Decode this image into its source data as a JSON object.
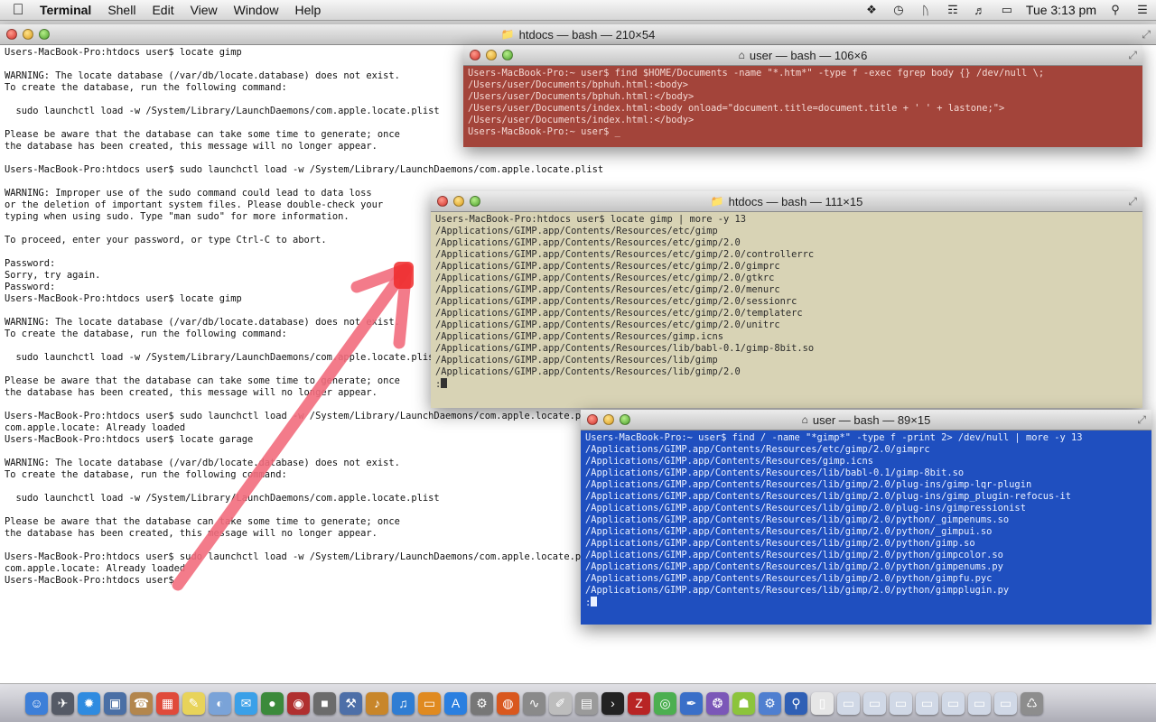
{
  "menubar": {
    "apple_icon": "apple-icon",
    "app_name": "Terminal",
    "menus": [
      "Shell",
      "Edit",
      "View",
      "Window",
      "Help"
    ],
    "clock": "Tue 3:13 pm",
    "status_icons": [
      "dropbox-icon",
      "time-machine-icon",
      "bluetooth-icon",
      "wifi-icon",
      "volume-icon",
      "battery-icon",
      "spotlight-search-icon",
      "notification-list-icon"
    ]
  },
  "main_window": {
    "title": "htdocs — bash — 210×54",
    "lines": [
      "Users-MacBook-Pro:htdocs user$ locate gimp",
      "",
      "WARNING: The locate database (/var/db/locate.database) does not exist.",
      "To create the database, run the following command:",
      "",
      "  sudo launchctl load -w /System/Library/LaunchDaemons/com.apple.locate.plist",
      "",
      "Please be aware that the database can take some time to generate; once",
      "the database has been created, this message will no longer appear.",
      "",
      "Users-MacBook-Pro:htdocs user$ sudo launchctl load -w /System/Library/LaunchDaemons/com.apple.locate.plist",
      "",
      "WARNING: Improper use of the sudo command could lead to data loss",
      "or the deletion of important system files. Please double-check your",
      "typing when using sudo. Type \"man sudo\" for more information.",
      "",
      "To proceed, enter your password, or type Ctrl-C to abort.",
      "",
      "Password:",
      "Sorry, try again.",
      "Password:",
      "Users-MacBook-Pro:htdocs user$ locate gimp",
      "",
      "WARNING: The locate database (/var/db/locate.database) does not exist.",
      "To create the database, run the following command:",
      "",
      "  sudo launchctl load -w /System/Library/LaunchDaemons/com.apple.locate.plist",
      "",
      "Please be aware that the database can take some time to generate; once",
      "the database has been created, this message will no longer appear.",
      "",
      "Users-MacBook-Pro:htdocs user$ sudo launchctl load -w /System/Library/LaunchDaemons/com.apple.locate.plist",
      "com.apple.locate: Already loaded",
      "Users-MacBook-Pro:htdocs user$ locate garage",
      "",
      "WARNING: The locate database (/var/db/locate.database) does not exist.",
      "To create the database, run the following command:",
      "",
      "  sudo launchctl load -w /System/Library/LaunchDaemons/com.apple.locate.plist",
      "",
      "Please be aware that the database can take some time to generate; once",
      "the database has been created, this message will no longer appear.",
      "",
      "Users-MacBook-Pro:htdocs user$ sudo launchctl load -w /System/Library/LaunchDaemons/com.apple.locate.plist",
      "com.apple.locate: Already loaded",
      "Users-MacBook-Pro:htdocs user$ "
    ]
  },
  "red_window": {
    "title": "user — bash — 106×6",
    "lines": [
      "Users-MacBook-Pro:~ user$ find $HOME/Documents -name \"*.htm*\" -type f -exec fgrep body {} /dev/null \\;",
      "/Users/user/Documents/bphuh.html:<body>",
      "/Users/user/Documents/bphuh.html:</body>",
      "/Users/user/Documents/index.html:<body onload=\"document.title=document.title + ' ' + lastone;\">",
      "/Users/user/Documents/index.html:</body>",
      "Users-MacBook-Pro:~ user$ _"
    ]
  },
  "beige_window": {
    "title": "htdocs — bash — 111×15",
    "lines": [
      "Users-MacBook-Pro:htdocs user$ locate gimp | more -y 13",
      "/Applications/GIMP.app/Contents/Resources/etc/gimp",
      "/Applications/GIMP.app/Contents/Resources/etc/gimp/2.0",
      "/Applications/GIMP.app/Contents/Resources/etc/gimp/2.0/controllerrc",
      "/Applications/GIMP.app/Contents/Resources/etc/gimp/2.0/gimprc",
      "/Applications/GIMP.app/Contents/Resources/etc/gimp/2.0/gtkrc",
      "/Applications/GIMP.app/Contents/Resources/etc/gimp/2.0/menurc",
      "/Applications/GIMP.app/Contents/Resources/etc/gimp/2.0/sessionrc",
      "/Applications/GIMP.app/Contents/Resources/etc/gimp/2.0/templaterc",
      "/Applications/GIMP.app/Contents/Resources/etc/gimp/2.0/unitrc",
      "/Applications/GIMP.app/Contents/Resources/gimp.icns",
      "/Applications/GIMP.app/Contents/Resources/lib/babl-0.1/gimp-8bit.so",
      "/Applications/GIMP.app/Contents/Resources/lib/gimp",
      "/Applications/GIMP.app/Contents/Resources/lib/gimp/2.0"
    ],
    "prompt": ":"
  },
  "blue_window": {
    "title": "user — bash — 89×15",
    "lines": [
      "Users-MacBook-Pro:~ user$ find / -name \"*gimp*\" -type f -print 2> /dev/null | more -y 13",
      "/Applications/GIMP.app/Contents/Resources/etc/gimp/2.0/gimprc",
      "/Applications/GIMP.app/Contents/Resources/gimp.icns",
      "/Applications/GIMP.app/Contents/Resources/lib/babl-0.1/gimp-8bit.so",
      "/Applications/GIMP.app/Contents/Resources/lib/gimp/2.0/plug-ins/gimp-lqr-plugin",
      "/Applications/GIMP.app/Contents/Resources/lib/gimp/2.0/plug-ins/gimp_plugin-refocus-it",
      "/Applications/GIMP.app/Contents/Resources/lib/gimp/2.0/plug-ins/gimpressionist",
      "/Applications/GIMP.app/Contents/Resources/lib/gimp/2.0/python/_gimpenums.so",
      "/Applications/GIMP.app/Contents/Resources/lib/gimp/2.0/python/_gimpui.so",
      "/Applications/GIMP.app/Contents/Resources/lib/gimp/2.0/python/gimp.so",
      "/Applications/GIMP.app/Contents/Resources/lib/gimp/2.0/python/gimpcolor.so",
      "/Applications/GIMP.app/Contents/Resources/lib/gimp/2.0/python/gimpenums.py",
      "/Applications/GIMP.app/Contents/Resources/lib/gimp/2.0/python/gimpfu.pyc",
      "/Applications/GIMP.app/Contents/Resources/lib/gimp/2.0/python/gimpplugin.py"
    ],
    "prompt": ":"
  },
  "colors": {
    "red_bg": "#a3443a",
    "beige_bg": "#d8d3b5",
    "blue_bg": "#1f4fbf",
    "arrow": "#f26d7d"
  },
  "dock": {
    "items": [
      {
        "icon": "finder-icon",
        "color": "#3d7fd8"
      },
      {
        "icon": "launchpad-icon",
        "color": "#555a66"
      },
      {
        "icon": "safari-icon",
        "color": "#2f8be0"
      },
      {
        "icon": "preview-icon",
        "color": "#4a6fa5"
      },
      {
        "icon": "contacts-icon",
        "color": "#b3864d"
      },
      {
        "icon": "calendar-icon",
        "color": "#e04a3a"
      },
      {
        "icon": "stickies-icon",
        "color": "#e8d35a"
      },
      {
        "icon": "photos-icon",
        "color": "#7aa3d8"
      },
      {
        "icon": "messages-icon",
        "color": "#3aa0e8"
      },
      {
        "icon": "facetime-icon",
        "color": "#3b8a3b"
      },
      {
        "icon": "photo-booth-icon",
        "color": "#b03030"
      },
      {
        "icon": "image-capture-icon",
        "color": "#6b6b6b"
      },
      {
        "icon": "xcode-icon",
        "color": "#4d6fa8"
      },
      {
        "icon": "guitar-icon",
        "color": "#c8862a"
      },
      {
        "icon": "itunes-icon",
        "color": "#2f7dd3"
      },
      {
        "icon": "ibooks-icon",
        "color": "#e08a20"
      },
      {
        "icon": "app-store-icon",
        "color": "#2a7fe0"
      },
      {
        "icon": "system-preferences-icon",
        "color": "#777777"
      },
      {
        "icon": "firefox-icon",
        "color": "#d9581e"
      },
      {
        "icon": "grapher-icon",
        "color": "#8a8a8a"
      },
      {
        "icon": "textedit-icon",
        "color": "#bdbdbd"
      },
      {
        "icon": "utility-icon",
        "color": "#9a9a9a"
      },
      {
        "icon": "terminal-icon",
        "color": "#222222"
      },
      {
        "icon": "filezilla-icon",
        "color": "#b82424"
      },
      {
        "icon": "chrome-icon",
        "color": "#4caf50"
      },
      {
        "icon": "paintbrush-icon",
        "color": "#3a6fc8"
      },
      {
        "icon": "gimp-icon",
        "color": "#7b57b8"
      },
      {
        "icon": "android-icon",
        "color": "#8cc43c"
      },
      {
        "icon": "settings-icon",
        "color": "#4f7fd0"
      },
      {
        "icon": "magnifier-icon",
        "color": "#2f5fb5"
      },
      {
        "icon": "document-icon",
        "color": "#e6e6e6"
      },
      {
        "icon": "window-icon",
        "color": "#d0d8e6"
      },
      {
        "icon": "window-icon",
        "color": "#d0d8e6"
      },
      {
        "icon": "window-icon",
        "color": "#d0d8e6"
      },
      {
        "icon": "window-icon",
        "color": "#d0d8e6"
      },
      {
        "icon": "window-icon",
        "color": "#d0d8e6"
      },
      {
        "icon": "window-icon",
        "color": "#d0d8e6"
      },
      {
        "icon": "window-icon",
        "color": "#d0d8e6"
      },
      {
        "icon": "trash-icon",
        "color": "#8d8d8d"
      }
    ]
  }
}
